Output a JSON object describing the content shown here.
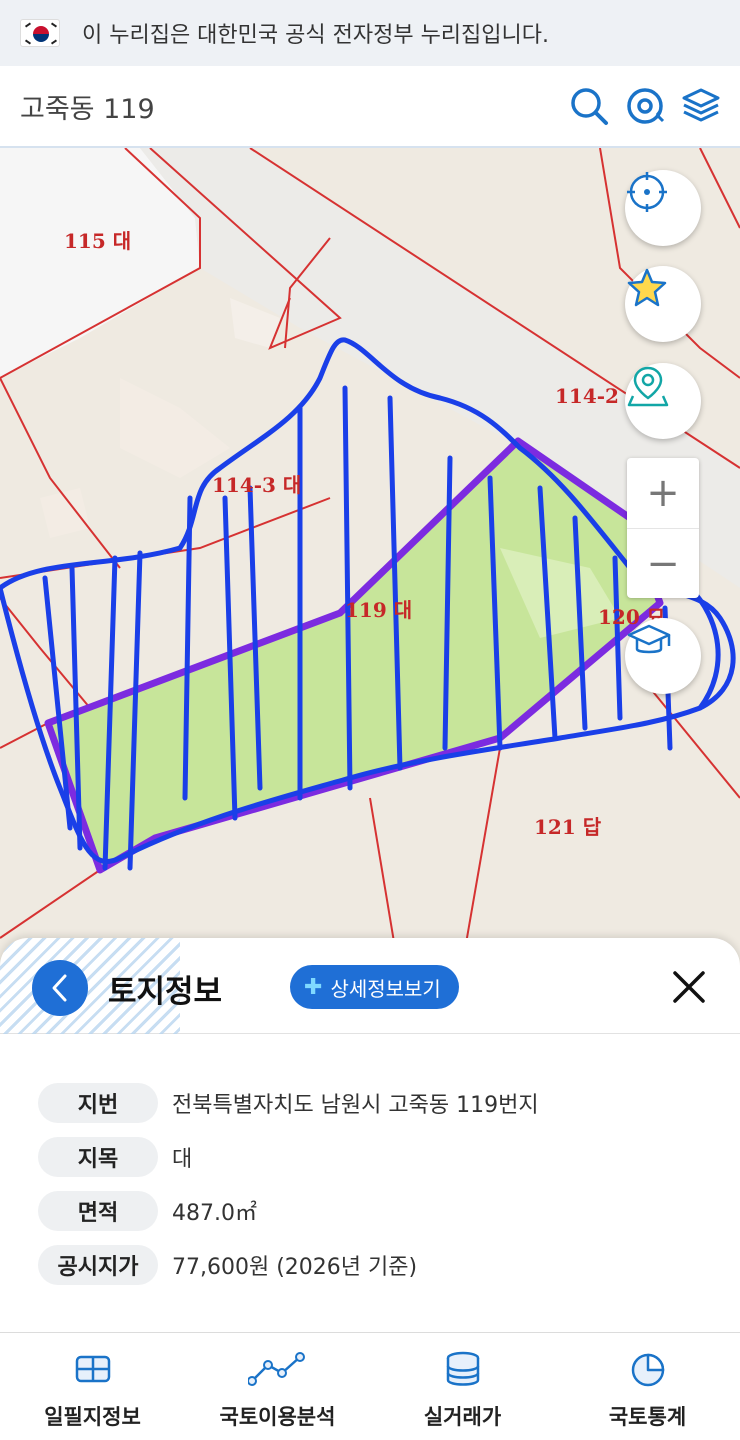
{
  "gov_banner": {
    "text": "이 누리집은 대한민국 공식 전자정부 누리집입니다."
  },
  "search": {
    "query": "고죽동 119"
  },
  "top_icons": [
    "search-icon",
    "location-target-icon",
    "layers-icon"
  ],
  "map": {
    "parcel_labels": {
      "p115": "115 대",
      "p1142": "114-2",
      "p1143": "114-3 대",
      "p119": "119 대",
      "p120": "120 묘",
      "p121": "121 답"
    },
    "controls": {
      "zoom_in": "+",
      "zoom_out": "−"
    },
    "buttons": [
      "current-location-icon",
      "star-icon",
      "map-pin-icon",
      "graduation-cap-icon"
    ],
    "colors": {
      "parcel_fill": "#c7e59a",
      "parcel_outline": "#7c2be0",
      "annotation": "#1a3fe8",
      "boundary": "#d63232"
    }
  },
  "panel": {
    "title": "토지정보",
    "detail_button": "상세정보보기",
    "rows": [
      {
        "label": "지번",
        "value": "전북특별자치도 남원시 고죽동 119번지"
      },
      {
        "label": "지목",
        "value": "대"
      },
      {
        "label": "면적",
        "value": "487.0㎡"
      },
      {
        "label": "공시지가",
        "value": "77,600원 (2026년 기준)"
      }
    ]
  },
  "bottom_nav": {
    "items": [
      {
        "label": "일필지정보",
        "icon": "map-grid-icon"
      },
      {
        "label": "국토이용분석",
        "icon": "line-graph-icon"
      },
      {
        "label": "실거래가",
        "icon": "database-icon"
      },
      {
        "label": "국토통계",
        "icon": "pie-chart-icon"
      }
    ]
  }
}
